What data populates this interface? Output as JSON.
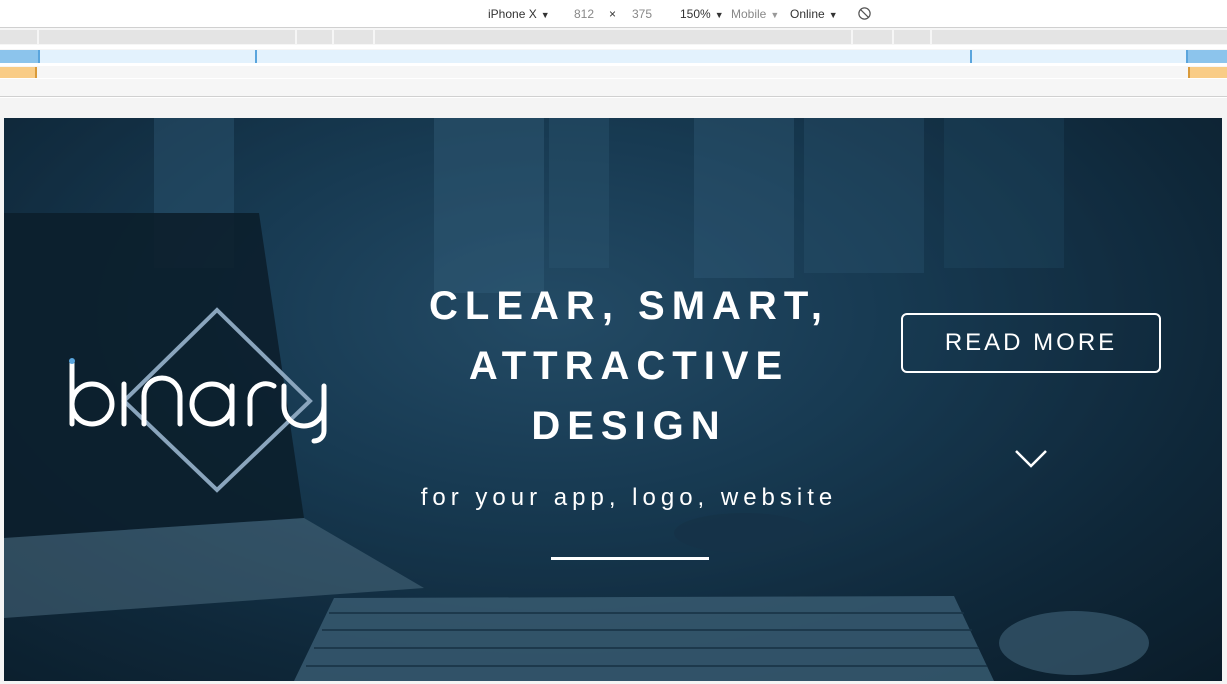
{
  "device_toolbar": {
    "device": "iPhone X",
    "width": "812",
    "times": "×",
    "height": "375",
    "zoom": "150%",
    "mode": "Mobile",
    "network": "Online",
    "rotate_icon": "rotate-icon"
  },
  "hero": {
    "logo_text": "binary",
    "headline": [
      "CLEAR, SMART,",
      "ATTRACTIVE",
      "DESIGN"
    ],
    "tagline": "for your app, logo, website",
    "read_more_label": "READ MORE",
    "scroll_icon": "chevron-down-icon"
  },
  "colors": {
    "hero_overlay": "#1d4663",
    "media_blue": "#8cc4ec",
    "media_orange": "#f9cc86",
    "text": "#ffffff"
  }
}
